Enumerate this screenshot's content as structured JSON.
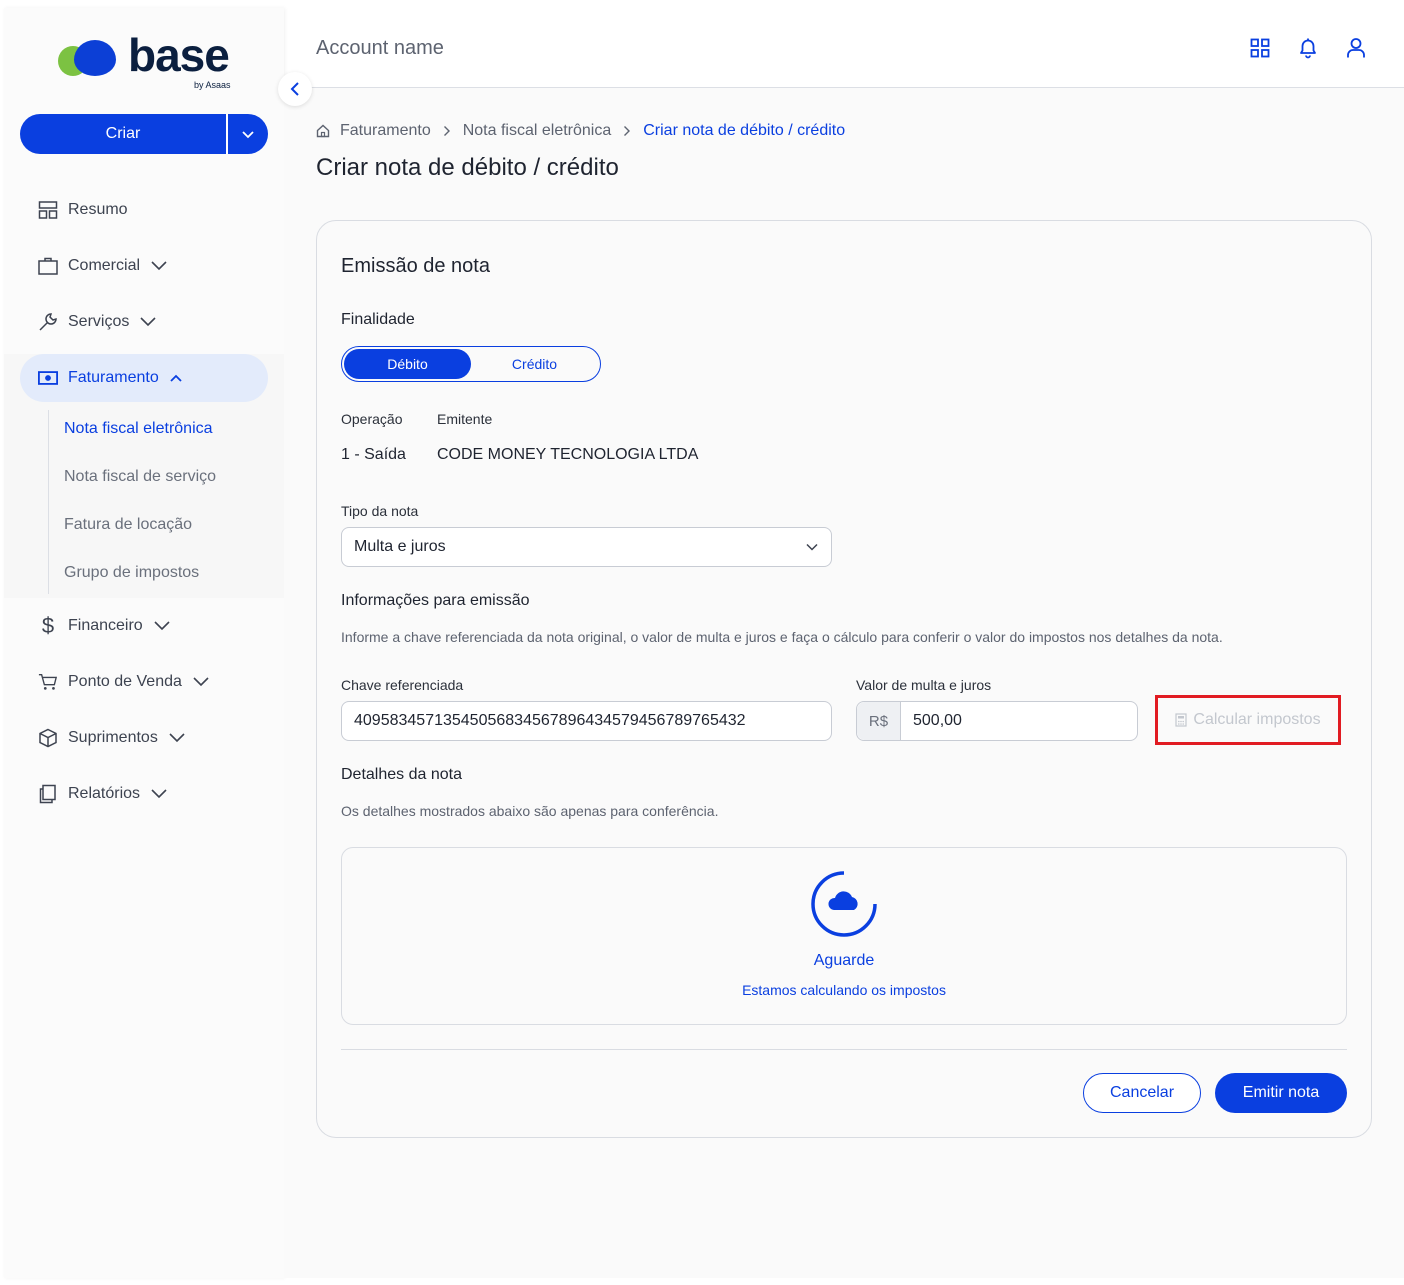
{
  "brand": {
    "name": "base",
    "by": "by Asaas"
  },
  "sidebar": {
    "create_label": "Criar",
    "items": [
      {
        "label": "Resumo",
        "icon": "dashboard-icon"
      },
      {
        "label": "Comercial",
        "icon": "briefcase-icon"
      },
      {
        "label": "Serviços",
        "icon": "wrench-icon"
      },
      {
        "label": "Faturamento",
        "icon": "money-icon"
      },
      {
        "label": "Financeiro",
        "icon": "dollar-icon"
      },
      {
        "label": "Ponto de Venda",
        "icon": "cart-icon"
      },
      {
        "label": "Suprimentos",
        "icon": "box-icon"
      },
      {
        "label": "Relatórios",
        "icon": "documents-icon"
      }
    ],
    "sub_items": [
      {
        "label": "Nota fiscal eletrônica"
      },
      {
        "label": "Nota fiscal de serviço"
      },
      {
        "label": "Fatura de locação"
      },
      {
        "label": "Grupo de impostos"
      }
    ]
  },
  "header": {
    "account": "Account name"
  },
  "breadcrumb": {
    "items": [
      "Faturamento",
      "Nota fiscal eletrônica",
      "Criar nota de débito / crédito"
    ]
  },
  "page": {
    "title": "Criar nota de débito / crédito"
  },
  "card": {
    "title": "Emissão de nota",
    "finalidade_label": "Finalidade",
    "toggle": {
      "debito": "Débito",
      "credito": "Crédito",
      "selected": "Débito"
    },
    "operacao_label": "Operação",
    "operacao_value": "1 - Saída",
    "emitente_label": "Emitente",
    "emitente_value": "CODE MONEY TECNOLOGIA LTDA",
    "tipo_label": "Tipo da nota",
    "tipo_value": "Multa e juros",
    "info_title": "Informações para emissão",
    "info_help": "Informe a chave referenciada da nota original, o valor de multa e juros e faça o cálculo para conferir o valor do impostos nos detalhes da nota.",
    "chave_label": "Chave referenciada",
    "chave_value": "40958345713545056834567896434579456789765432",
    "valor_label": "Valor de multa e juros",
    "valor_prefix": "R$",
    "valor_value": "500,00",
    "calc_label": "Calcular impostos",
    "details_title": "Detalhes da nota",
    "details_help": "Os detalhes mostrados abaixo são apenas para conferência.",
    "wait_title": "Aguarde",
    "wait_sub": "Estamos calculando os impostos",
    "cancel_label": "Cancelar",
    "emit_label": "Emitir nota"
  },
  "colors": {
    "primary": "#0a3fe0",
    "highlight": "#e11b22",
    "accent_green": "#7cc242"
  }
}
